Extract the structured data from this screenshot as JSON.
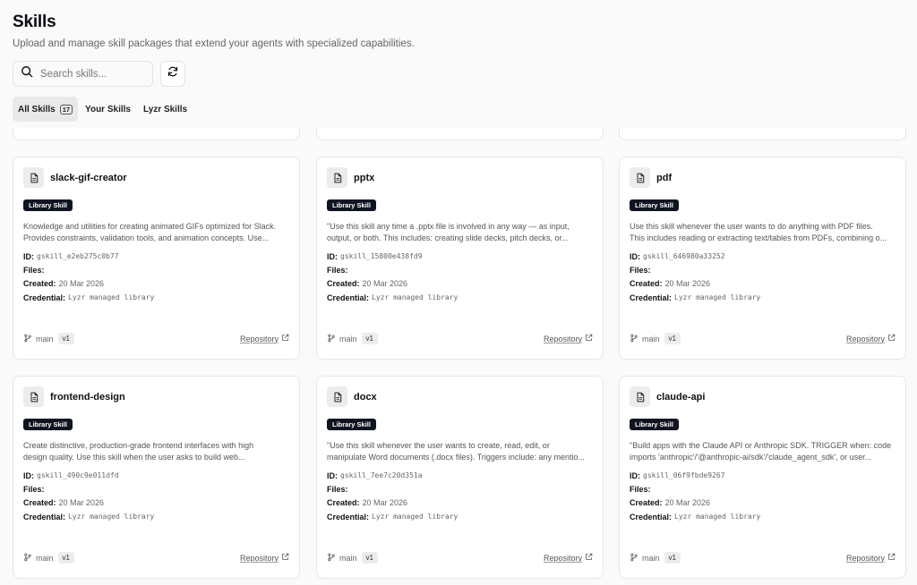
{
  "header": {
    "title": "Skills",
    "subtitle": "Upload and manage skill packages that extend your agents with specialized capabilities."
  },
  "search": {
    "placeholder": "Search skills...",
    "value": ""
  },
  "tabs": [
    {
      "label": "All Skills",
      "count": "17"
    },
    {
      "label": "Your Skills"
    },
    {
      "label": "Lyzr Skills"
    }
  ],
  "labels": {
    "badge": "Library Skill",
    "id": "ID:",
    "files": "Files:",
    "created": "Created:",
    "credential": "Credential:",
    "repository": "Repository"
  },
  "cards": [
    {
      "name": "slack-gif-creator",
      "desc1": "Knowledge and utilities for creating animated GIFs optimized for Slack.",
      "desc2": "Provides constraints, validation tools, and animation concepts. Use...",
      "id": "gskill_e2eb275c0b77",
      "created": "20 Mar 2026",
      "credential": "Lyzr managed library",
      "branch": "main",
      "version": "v1"
    },
    {
      "name": "pptx",
      "desc1": "\"Use this skill any time a .pptx file is involved in any way — as input,",
      "desc2": "output, or both. This includes: creating slide decks, pitch decks, or...",
      "id": "gskill_15800e438fd9",
      "created": "20 Mar 2026",
      "credential": "Lyzr managed library",
      "branch": "main",
      "version": "v1"
    },
    {
      "name": "pdf",
      "desc1": "Use this skill whenever the user wants to do anything with PDF files.",
      "desc2": "This includes reading or extracting text/tables from PDFs, combining o...",
      "id": "gskill_646980a33252",
      "created": "20 Mar 2026",
      "credential": "Lyzr managed library",
      "branch": "main",
      "version": "v1"
    },
    {
      "name": "frontend-design",
      "desc1": "Create distinctive, production-grade frontend interfaces with high",
      "desc2": "design quality. Use this skill when the user asks to build web...",
      "id": "gskill_490c9e011dfd",
      "created": "20 Mar 2026",
      "credential": "Lyzr managed library",
      "branch": "main",
      "version": "v1"
    },
    {
      "name": "docx",
      "desc1": "\"Use this skill whenever the user wants to create, read, edit, or",
      "desc2": "manipulate Word documents (.docx files). Triggers include: any mentio...",
      "id": "gskill_7ee7c20d351a",
      "created": "20 Mar 2026",
      "credential": "Lyzr managed library",
      "branch": "main",
      "version": "v1"
    },
    {
      "name": "claude-api",
      "desc1": "\"Build apps with the Claude API or Anthropic SDK. TRIGGER when: code",
      "desc2": "imports 'anthropic'/'@anthropic-ai/sdk'/'claude_agent_sdk', or user...",
      "id": "gskill_06f9fbde9267",
      "created": "20 Mar 2026",
      "credential": "Lyzr managed library",
      "branch": "main",
      "version": "v1"
    }
  ]
}
